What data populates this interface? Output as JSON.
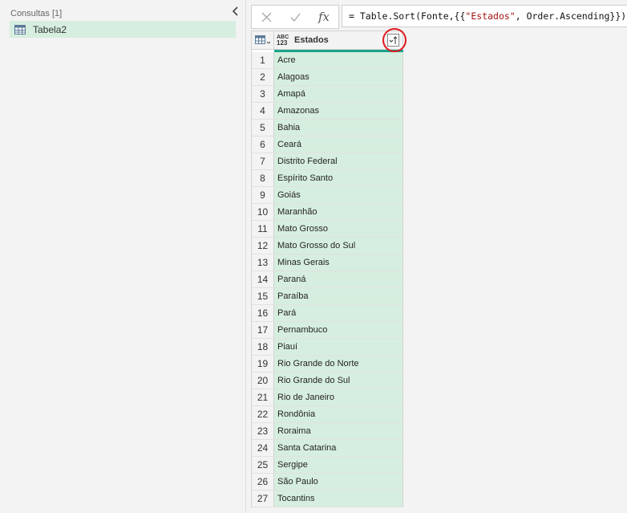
{
  "queries": {
    "header": "Consultas [1]",
    "items": [
      {
        "name": "Tabela2"
      }
    ]
  },
  "formula": {
    "prefix": "= Table.Sort(Fonte,{{",
    "string": "\"Estados\"",
    "suffix": ", Order.Ascending}})"
  },
  "grid": {
    "column": {
      "title": "Estados",
      "type_top": "ABC",
      "type_bottom": "123"
    },
    "rows": [
      "Acre",
      "Alagoas",
      "Amapá",
      "Amazonas",
      "Bahia",
      "Ceará",
      "Distrito Federal",
      "Espírito Santo",
      "Goiás",
      "Maranhão",
      "Mato Grosso",
      "Mato Grosso do Sul",
      "Minas Gerais",
      "Paraná",
      "Paraíba",
      "Pará",
      "Pernambuco",
      "Piauí",
      "Rio Grande do Norte",
      "Rio Grande do Sul",
      "Rio de Janeiro",
      "Rondônia",
      "Roraima",
      "Santa Catarina",
      "Sergipe",
      "São Paulo",
      "Tocantins"
    ]
  },
  "colors": {
    "accent": "#1aa38a",
    "selection": "#d6eedf",
    "highlight": "#e0191e"
  }
}
